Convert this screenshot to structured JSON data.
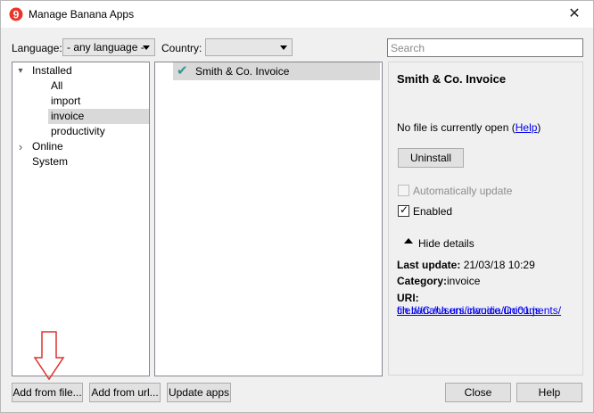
{
  "window": {
    "title": "Manage Banana Apps",
    "close_glyph": "✕",
    "icon": "banana-app-icon"
  },
  "filters": {
    "language_label": "Language:",
    "language_value": "- any language -",
    "country_label": "Country:",
    "country_value": "",
    "search_placeholder": "Search",
    "search_value": ""
  },
  "categories": {
    "items": [
      {
        "label": "Installed",
        "expander": "▾",
        "level": 0,
        "selected": false
      },
      {
        "label": "All",
        "level": 1,
        "selected": false
      },
      {
        "label": "import",
        "level": 1,
        "selected": false
      },
      {
        "label": "invoice",
        "level": 1,
        "selected": true
      },
      {
        "label": "productivity",
        "level": 1,
        "selected": false
      },
      {
        "label": "Online",
        "expander": "›",
        "level": 0,
        "selected": false
      },
      {
        "label": "System",
        "level": 0,
        "selected": false
      }
    ]
  },
  "apps": {
    "items": [
      {
        "name": "Smith & Co. Invoice",
        "installed_glyph": "✔"
      }
    ]
  },
  "details": {
    "title": "Smith & Co. Invoice",
    "no_file_text": "No file is currently open (",
    "help_link": "Help",
    "no_file_close": ")",
    "uninstall_label": "Uninstall",
    "auto_update_label": "Automatically update",
    "auto_update_checked": false,
    "enabled_label": "Enabled",
    "enabled_checked": true,
    "hide_details_label": "Hide details",
    "last_update_key": "Last update:",
    "last_update_value": "21/03/18 10:29",
    "category_key": "Category:",
    "category_value": "invoice",
    "uri_key": "URI:",
    "uri_line1": "file:///C:/Users/claudia/Documents/",
    "uri_line2": "ch.banana.uni.invoice.uni01.js"
  },
  "footer": {
    "add_from_file": "Add from file...",
    "add_from_url": "Add from url...",
    "update_apps": "Update apps",
    "close": "Close",
    "help": "Help"
  },
  "colors": {
    "installed_check": "#2b9a95",
    "selection": "#d9d9d9",
    "annotation_arrow": "#e03030",
    "link": "#0000ee"
  }
}
